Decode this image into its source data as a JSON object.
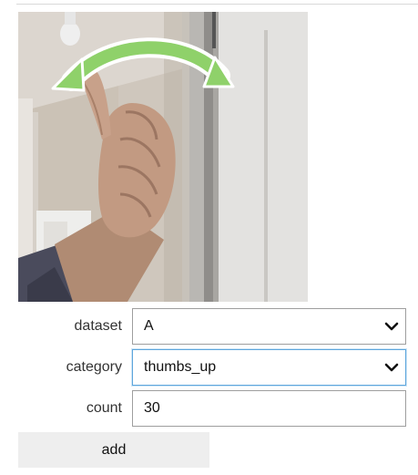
{
  "preview": {
    "icon": "swipe-arrow-icon",
    "arrow_color": "#8fd16a",
    "arrow_outline": "#ffffff"
  },
  "form": {
    "dataset": {
      "label": "dataset",
      "value": "A"
    },
    "category": {
      "label": "category",
      "value": "thumbs_up"
    },
    "count": {
      "label": "count",
      "value": "30"
    },
    "add_label": "add"
  },
  "colors": {
    "focus_border": "#5ea6dc",
    "field_border": "#9e9e9e",
    "button_bg": "#eeeeee"
  }
}
